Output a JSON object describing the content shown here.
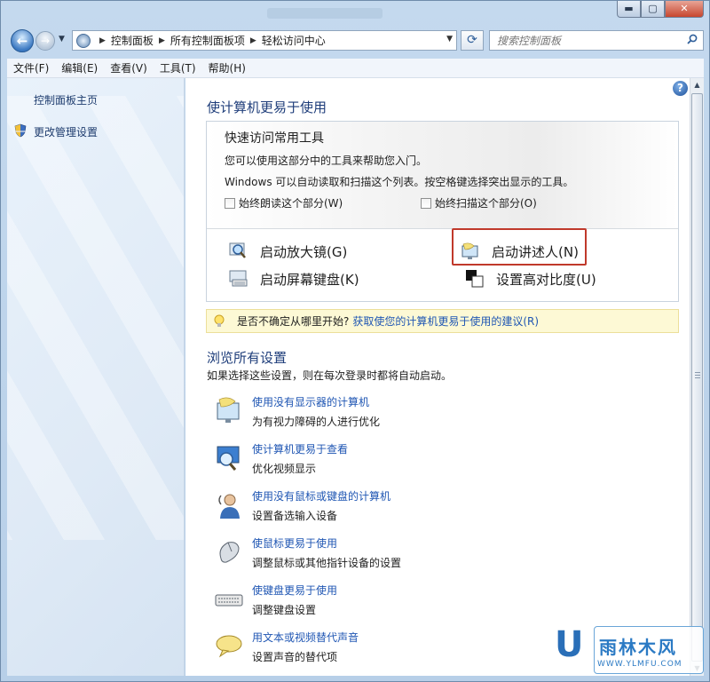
{
  "window": {
    "buttons": {
      "minimize": "▬",
      "maximize": "▢",
      "close": "✕"
    }
  },
  "address_bar": {
    "crumbs": [
      "控制面板",
      "所有控制面板项",
      "轻松访问中心"
    ],
    "search_placeholder": "搜索控制面板"
  },
  "menu": [
    "文件(F)",
    "编辑(E)",
    "查看(V)",
    "工具(T)",
    "帮助(H)"
  ],
  "sidebar": {
    "items": [
      "控制面板主页",
      "更改管理设置"
    ]
  },
  "main": {
    "title": "使计算机更易于使用",
    "quick_access": {
      "title": "快速访问常用工具",
      "line1": "您可以使用这部分中的工具来帮助您入门。",
      "line2": "Windows 可以自动读取和扫描这个列表。按空格键选择突出显示的工具。",
      "checkbox_read": "始终朗读这个部分(W)",
      "checkbox_scan": "始终扫描这个部分(O)",
      "tools": {
        "magnifier": "启动放大镜(G)",
        "narrator": "启动讲述人(N)",
        "osk": "启动屏幕键盘(K)",
        "high_contrast": "设置高对比度(U)"
      }
    },
    "tip": {
      "question": "是否不确定从哪里开始?",
      "link": "获取使您的计算机更易于使用的建议(R)"
    },
    "browse": {
      "title": "浏览所有设置",
      "subtitle": "如果选择这些设置，则在每次登录时都将自动启动。",
      "items": [
        {
          "link": "使用没有显示器的计算机",
          "desc": "为有视力障碍的人进行优化"
        },
        {
          "link": "使计算机更易于查看",
          "desc": "优化视频显示"
        },
        {
          "link": "使用没有鼠标或键盘的计算机",
          "desc": "设置备选输入设备"
        },
        {
          "link": "使鼠标更易于使用",
          "desc": "调整鼠标或其他指针设备的设置"
        },
        {
          "link": "使键盘更易于使用",
          "desc": "调整键盘设置"
        },
        {
          "link": "用文本或视频替代声音",
          "desc": "设置声音的替代项"
        }
      ]
    }
  },
  "watermark": {
    "logo": "U",
    "text": "雨林木风",
    "url": "WWW.YLMFU.COM"
  }
}
